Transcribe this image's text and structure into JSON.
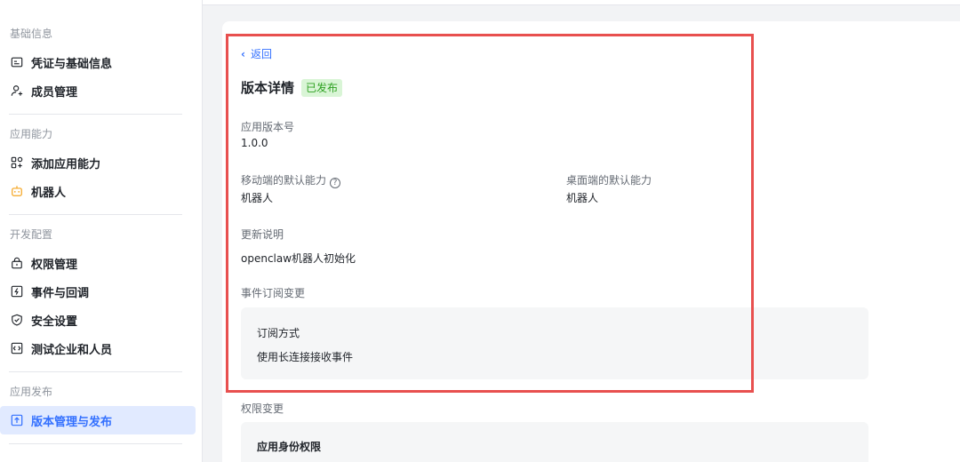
{
  "sidebar": {
    "groups": [
      {
        "title": "基础信息",
        "items": [
          {
            "label": "凭证与基础信息",
            "icon": "credential-icon"
          },
          {
            "label": "成员管理",
            "icon": "member-add-icon"
          }
        ]
      },
      {
        "title": "应用能力",
        "items": [
          {
            "label": "添加应用能力",
            "icon": "apps-add-icon"
          },
          {
            "label": "机器人",
            "icon": "robot-icon"
          }
        ]
      },
      {
        "title": "开发配置",
        "items": [
          {
            "label": "权限管理",
            "icon": "lock-icon"
          },
          {
            "label": "事件与回调",
            "icon": "event-icon"
          },
          {
            "label": "安全设置",
            "icon": "shield-icon"
          },
          {
            "label": "测试企业和人员",
            "icon": "code-icon"
          }
        ]
      },
      {
        "title": "应用发布",
        "items": [
          {
            "label": "版本管理与发布",
            "icon": "upload-icon",
            "active": true
          }
        ]
      }
    ]
  },
  "detail": {
    "back_label": "返回",
    "title": "版本详情",
    "status_badge": "已发布",
    "version_label": "应用版本号",
    "version_value": "1.0.0",
    "mobile_default_label": "移动端的默认能力",
    "mobile_default_value": "机器人",
    "desktop_default_label": "桌面端的默认能力",
    "desktop_default_value": "机器人",
    "update_notes_label": "更新说明",
    "update_notes_value": "openclaw机器人初始化",
    "event_changes_label": "事件订阅变更",
    "subscription_method_label": "订阅方式",
    "subscription_method_value": "使用长连接接收事件",
    "permission_changes_label": "权限变更",
    "app_identity_permissions_label": "应用身份权限"
  },
  "colors": {
    "accent": "#3370ff",
    "active_bg": "#e1eaff",
    "badge_text": "#2ea121",
    "badge_bg": "#d9f5d6",
    "highlight_border": "#e8504f",
    "robot_icon": "#f5a623"
  }
}
